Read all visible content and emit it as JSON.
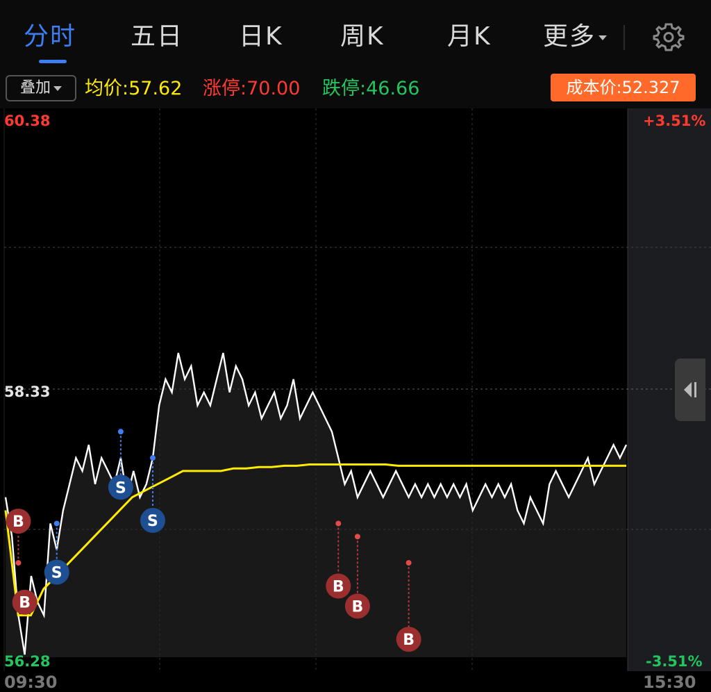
{
  "tabs": [
    {
      "label": "分时",
      "active": true
    },
    {
      "label": "五日",
      "active": false
    },
    {
      "label": "日K",
      "active": false
    },
    {
      "label": "周K",
      "active": false
    },
    {
      "label": "月K",
      "active": false
    },
    {
      "label": "更多",
      "active": false
    }
  ],
  "toolbar": {
    "overlay_label": "叠加",
    "avg_price": "均价:57.62",
    "limit_up": "涨停:70.00",
    "limit_down": "跌停:46.66",
    "cost_price": "成本价:52.327"
  },
  "axis": {
    "price_high": "60.38",
    "price_mid": "58.33",
    "price_low": "56.28",
    "pct_high": "+3.51%",
    "pct_low": "-3.51%",
    "time_start": "09:30",
    "time_end": "15:30"
  },
  "colors": {
    "accent": "#3d7ff2",
    "up": "#ff3b30",
    "down": "#22c55e",
    "avg_line": "#ffeb00",
    "price_line": "#ffffff",
    "buy_marker": "#a52a2a",
    "sell_marker": "#1e5aa8",
    "cost_button": "#ff6a2a"
  },
  "icons": {
    "settings": "gear-icon",
    "collapse": "panel-collapse-icon"
  },
  "chart_data": {
    "type": "line",
    "ylim": [
      56.28,
      60.38
    ],
    "xlabel": "",
    "ylabel": "",
    "series": [
      {
        "name": "",
        "values": [
          57.5,
          57.2,
          56.6,
          56.3,
          56.9,
          56.7,
          56.6,
          57.3,
          57.1,
          57.4,
          57.6,
          57.8,
          57.7,
          57.9,
          57.6,
          57.8,
          57.7,
          57.6,
          57.8,
          57.5,
          57.7,
          57.5,
          57.6,
          57.8,
          58.2,
          58.4,
          58.3,
          58.6,
          58.4,
          58.5,
          58.2,
          58.3,
          58.2,
          58.4,
          58.6,
          58.3,
          58.5,
          58.4,
          58.2,
          58.3,
          58.1,
          58.2,
          58.3,
          58.1,
          58.2,
          58.4,
          58.1,
          58.2,
          58.3,
          58.2,
          58.1,
          58.0,
          57.8,
          57.6,
          57.7,
          57.5,
          57.6,
          57.7,
          57.6,
          57.5,
          57.6,
          57.7,
          57.6,
          57.5,
          57.6,
          57.5,
          57.6,
          57.5,
          57.6,
          57.5,
          57.6,
          57.5,
          57.6,
          57.4,
          57.5,
          57.6,
          57.5,
          57.6,
          57.5,
          57.6,
          57.4,
          57.3,
          57.5,
          57.4,
          57.3,
          57.6,
          57.7,
          57.6,
          57.5,
          57.6,
          57.7,
          57.8,
          57.6,
          57.7,
          57.8,
          57.9,
          57.8,
          57.9
        ]
      },
      {
        "name": "",
        "values": [
          57.4,
          56.6,
          56.6,
          56.8,
          56.9,
          57.0,
          57.1,
          57.2,
          57.3,
          57.4,
          57.5,
          57.55,
          57.6,
          57.65,
          57.7,
          57.7,
          57.7,
          57.7,
          57.72,
          57.72,
          57.73,
          57.73,
          57.74,
          57.74,
          57.75,
          57.75,
          57.75,
          57.75,
          57.75,
          57.75,
          57.75,
          57.74,
          57.74,
          57.74,
          57.74,
          57.74,
          57.74,
          57.74,
          57.74,
          57.74,
          57.74,
          57.74,
          57.74,
          57.74,
          57.74,
          57.74,
          57.74,
          57.74,
          57.74,
          57.74
        ]
      }
    ],
    "trade_markers": [
      {
        "type": "B",
        "price": 57.0
      },
      {
        "type": "B",
        "price": 56.7
      },
      {
        "type": "S",
        "price": 57.3
      },
      {
        "type": "S",
        "price": 58.0
      },
      {
        "type": "S",
        "price": 57.8
      },
      {
        "type": "B",
        "price": 57.3
      },
      {
        "type": "B",
        "price": 57.2
      },
      {
        "type": "B",
        "price": 57.0
      }
    ]
  }
}
